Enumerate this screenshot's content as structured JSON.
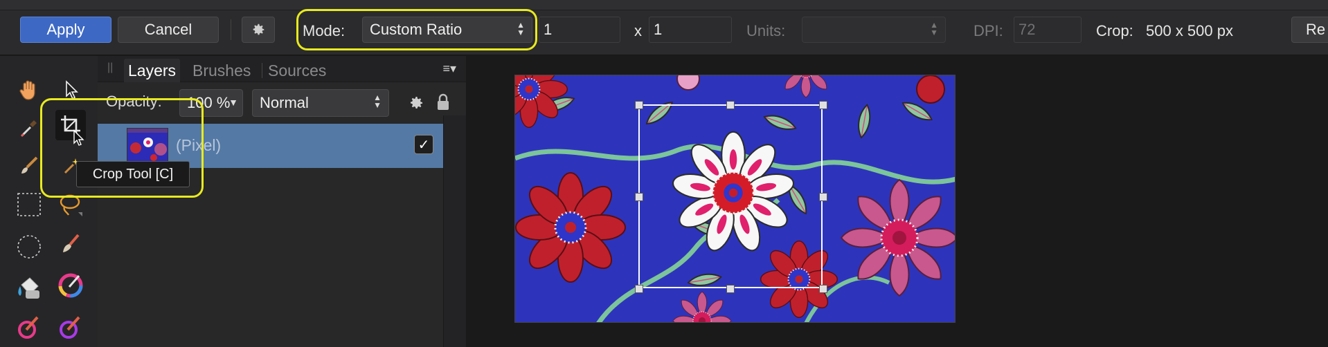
{
  "toolbar": {
    "apply_label": "Apply",
    "cancel_label": "Cancel",
    "mode_label": "Mode:",
    "mode_value": "Custom Ratio",
    "ratio_width": "1",
    "ratio_x": "x",
    "ratio_height": "1",
    "units_label": "Units:",
    "units_value": "",
    "dpi_label": "DPI:",
    "dpi_value": "72",
    "crop_label": "Crop:",
    "crop_value": "500 x 500 px",
    "reset_label": "Re"
  },
  "tools_panel": {
    "tooltip": "Crop Tool [C]",
    "tools": [
      "view-tool",
      "move-tool",
      "color-picker-tool",
      "crop-tool",
      "paint-brush-tool",
      "flood-select-tool",
      "rectangle-marquee-tool",
      "freehand-selection-tool",
      "ellipse-marquee-tool",
      "brush-tool",
      "fill-tool",
      "gradient-tool",
      "dodge-brush-tool",
      "burn-brush-tool"
    ]
  },
  "layers_panel": {
    "tabs": [
      "Layers",
      "Brushes",
      "Sources"
    ],
    "opacity_label": "Opacity:",
    "opacity_value": "100 %",
    "blend_mode": "Normal",
    "layer_name": "(Pixel)",
    "layer_visible": true
  },
  "colors": {
    "accent": "#3d68c4",
    "highlight": "#e8ea1f",
    "selected_layer": "#5479a5"
  }
}
